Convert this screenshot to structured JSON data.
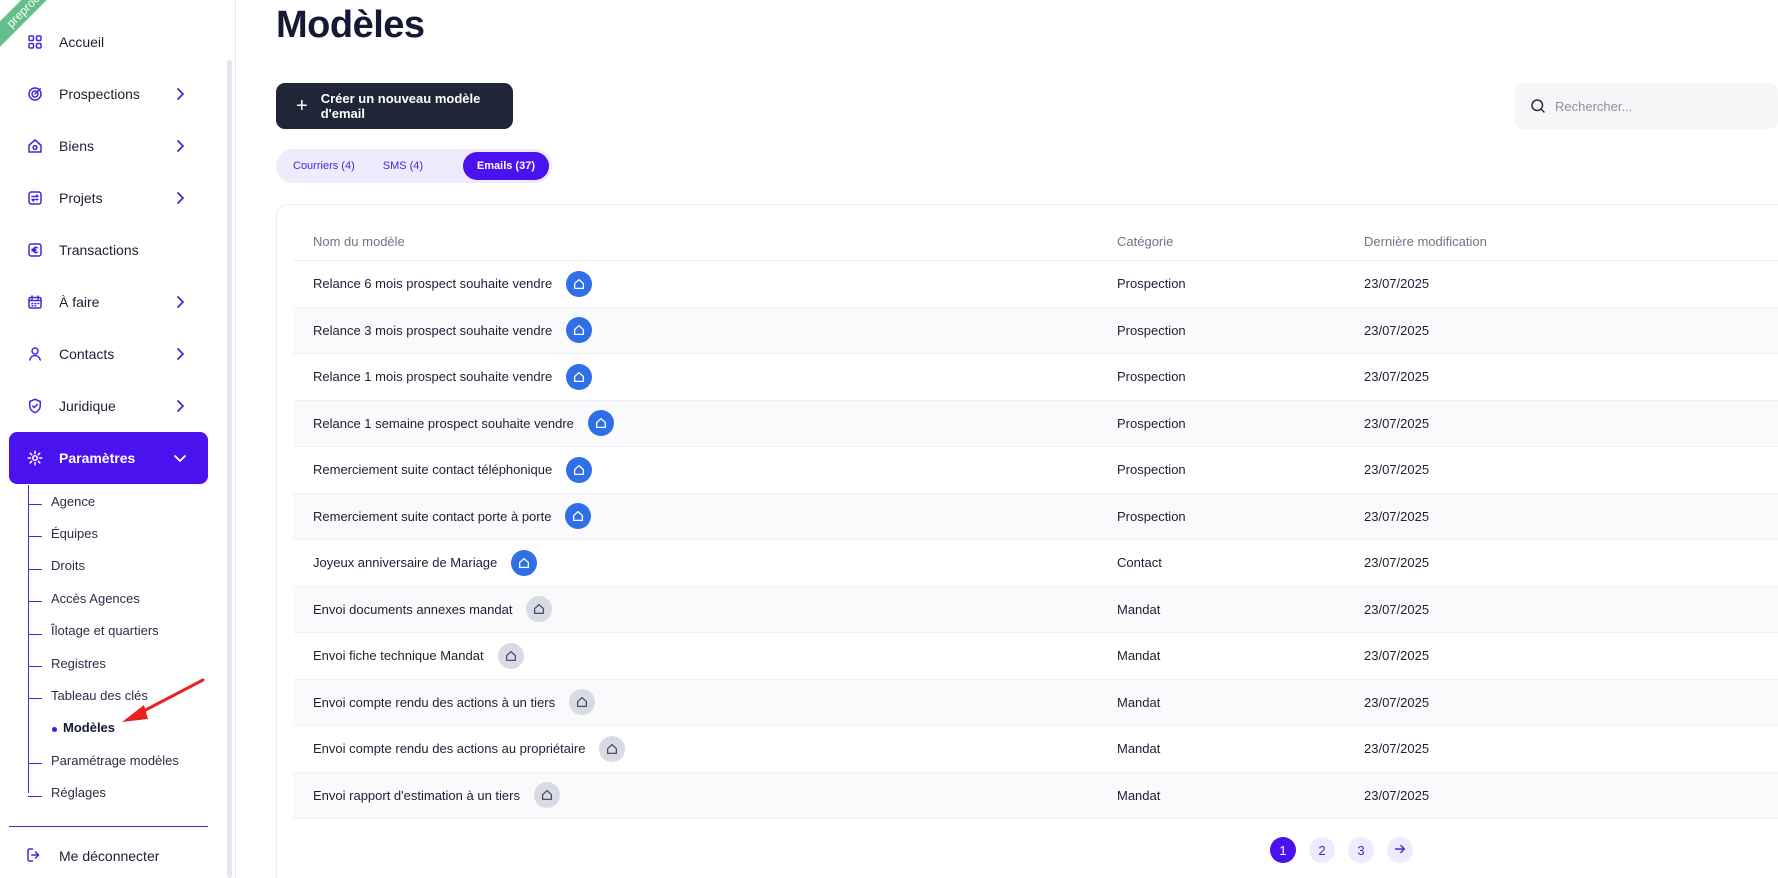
{
  "env_ribbon": "preproc",
  "sidebar": {
    "items": [
      {
        "label": "Accueil",
        "icon": "grid-icon",
        "has_chevron": false
      },
      {
        "label": "Prospections",
        "icon": "target-icon",
        "has_chevron": true
      },
      {
        "label": "Biens",
        "icon": "home-search-icon",
        "has_chevron": true
      },
      {
        "label": "Projets",
        "icon": "swap-icon",
        "has_chevron": true
      },
      {
        "label": "Transactions",
        "icon": "euro-icon",
        "has_chevron": false
      },
      {
        "label": "À faire",
        "icon": "calendar-icon",
        "has_chevron": true
      },
      {
        "label": "Contacts",
        "icon": "user-icon",
        "has_chevron": true
      },
      {
        "label": "Juridique",
        "icon": "shield-check-icon",
        "has_chevron": true
      },
      {
        "label": "Paramètres",
        "icon": "gear-icon",
        "has_chevron": true,
        "active": true
      }
    ],
    "sub_items": [
      {
        "label": "Agence"
      },
      {
        "label": "Équipes"
      },
      {
        "label": "Droits"
      },
      {
        "label": "Accès Agences"
      },
      {
        "label": "Îlotage et quartiers"
      },
      {
        "label": "Registres"
      },
      {
        "label": "Tableau des clés"
      },
      {
        "label": "Modèles",
        "active": true
      },
      {
        "label": "Paramétrage modèles"
      },
      {
        "label": "Réglages"
      }
    ],
    "logout_label": "Me déconnecter"
  },
  "main": {
    "title": "Modèles",
    "create_button_label": "Créer un nouveau modèle d'email",
    "search_placeholder": "Rechercher...",
    "tabs": [
      {
        "label": "Courriers (4)"
      },
      {
        "label": "SMS (4)"
      },
      {
        "label": "Emails (37)",
        "active": true
      }
    ],
    "table": {
      "columns": [
        "Nom du modèle",
        "Catégorie",
        "Dernière modification"
      ],
      "rows": [
        {
          "name": "Relance 6 mois prospect souhaite vendre",
          "badge": "blue",
          "category": "Prospection",
          "date": "23/07/2025",
          "menu": true
        },
        {
          "name": "Relance 3 mois prospect souhaite vendre",
          "badge": "blue",
          "category": "Prospection",
          "date": "23/07/2025",
          "menu": true
        },
        {
          "name": "Relance 1 mois prospect souhaite vendre",
          "badge": "blue",
          "category": "Prospection",
          "date": "23/07/2025",
          "menu": true
        },
        {
          "name": "Relance 1 semaine prospect souhaite vendre",
          "badge": "blue",
          "category": "Prospection",
          "date": "23/07/2025",
          "menu": true
        },
        {
          "name": "Remerciement suite contact téléphonique",
          "badge": "blue",
          "category": "Prospection",
          "date": "23/07/2025",
          "menu": true
        },
        {
          "name": "Remerciement suite contact porte à porte",
          "badge": "blue",
          "category": "Prospection",
          "date": "23/07/2025",
          "menu": true
        },
        {
          "name": "Joyeux anniversaire de Mariage",
          "badge": "blue",
          "category": "Contact",
          "date": "23/07/2025",
          "menu": true
        },
        {
          "name": "Envoi documents annexes mandat",
          "badge": "grey",
          "category": "Mandat",
          "date": "23/07/2025",
          "menu": false
        },
        {
          "name": "Envoi fiche technique Mandat",
          "badge": "grey",
          "category": "Mandat",
          "date": "23/07/2025",
          "menu": false
        },
        {
          "name": "Envoi compte rendu des actions à un tiers",
          "badge": "grey",
          "category": "Mandat",
          "date": "23/07/2025",
          "menu": false
        },
        {
          "name": "Envoi compte rendu des actions au propriétaire",
          "badge": "grey",
          "category": "Mandat",
          "date": "23/07/2025",
          "menu": false
        },
        {
          "name": "Envoi rapport d'estimation à un tiers",
          "badge": "grey",
          "category": "Mandat",
          "date": "23/07/2025",
          "menu": false
        }
      ]
    },
    "pagination": {
      "pages": [
        "1",
        "2",
        "3"
      ],
      "current": "1",
      "next_icon": "arrow-right-icon"
    }
  },
  "colors": {
    "accent": "#4b12f0",
    "icon": "#3d2bd8",
    "dark_button": "#1e2637",
    "badge_blue": "#2f6fe8",
    "badge_grey": "#d8dbe3",
    "annotation_arrow": "#e8231e"
  }
}
